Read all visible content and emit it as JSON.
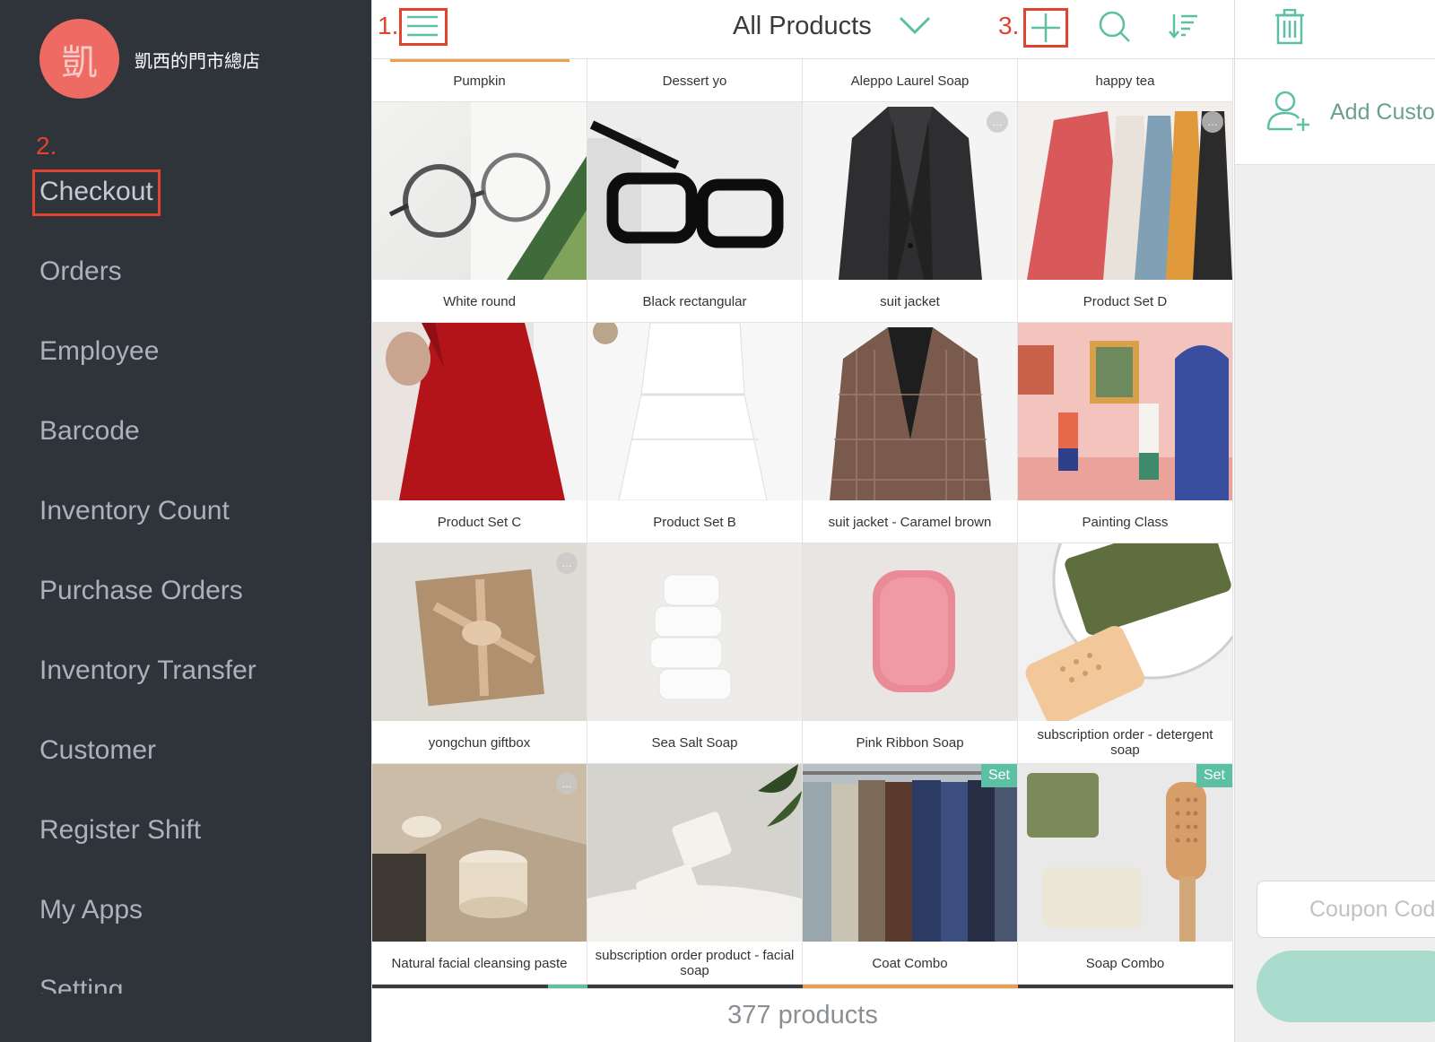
{
  "sidebar": {
    "avatar_char": "凱",
    "store_name": "凱西的門市總店",
    "annotation": "2.",
    "items": [
      {
        "label": "Checkout"
      },
      {
        "label": "Orders"
      },
      {
        "label": "Employee"
      },
      {
        "label": "Barcode"
      },
      {
        "label": "Inventory Count"
      },
      {
        "label": "Purchase Orders"
      },
      {
        "label": "Inventory Transfer"
      },
      {
        "label": "Customer"
      },
      {
        "label": "Register Shift"
      },
      {
        "label": "My Apps"
      },
      {
        "label": "Setting"
      }
    ]
  },
  "topbar": {
    "title": "All Products",
    "annotation_menu": "1.",
    "annotation_add": "3.",
    "icons": [
      "menu-icon",
      "chevron-down-icon",
      "add-icon",
      "search-icon",
      "sort-icon"
    ]
  },
  "products": {
    "partial_row": [
      "Pumpkin",
      "Dessert yo",
      "Aleppo Laurel Soap",
      "happy tea"
    ],
    "rows": [
      [
        {
          "name": "White round"
        },
        {
          "name": "Black rectangular"
        },
        {
          "name": "suit jacket",
          "more": "…"
        },
        {
          "name": "Product Set D",
          "more": "…"
        }
      ],
      [
        {
          "name": "Product Set C"
        },
        {
          "name": "Product Set B"
        },
        {
          "name": "suit jacket - Caramel brown"
        },
        {
          "name": "Painting Class"
        }
      ],
      [
        {
          "name": "yongchun giftbox",
          "more": "…"
        },
        {
          "name": "Sea Salt Soap"
        },
        {
          "name": "Pink Ribbon Soap"
        },
        {
          "name": "subscription order - detergent soap"
        }
      ],
      [
        {
          "name": "Natural facial cleansing paste",
          "more": "…"
        },
        {
          "name": "subscription order product - facial soap"
        },
        {
          "name": "Coat Combo",
          "badge": "Set"
        },
        {
          "name": "Soap Combo",
          "badge": "Set"
        }
      ]
    ],
    "count_text": "377 products"
  },
  "cart": {
    "add_customer": "Add Custo",
    "coupon_placeholder": "Coupon Cod",
    "icons": [
      "trash-icon",
      "add-customer-icon"
    ]
  },
  "colors": {
    "sidebar_bg": "#2f343a",
    "accent": "#5dbfa3",
    "annotation": "#e0442e",
    "avatar": "#ee6b64"
  }
}
